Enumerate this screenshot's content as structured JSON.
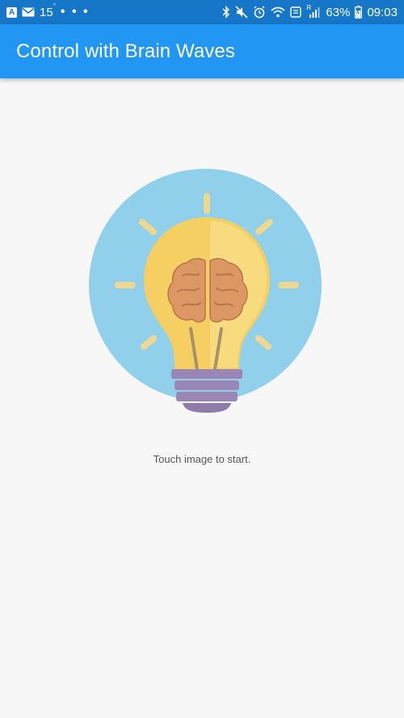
{
  "status_bar": {
    "notification_badge": "A",
    "temperature": "15",
    "temperature_unit": "°",
    "more_dots": "• • •",
    "battery_percent": "63%",
    "time": "09:03",
    "signal_label": "R"
  },
  "app_bar": {
    "title": "Control with Brain Waves"
  },
  "main": {
    "hint_text": "Touch image to start."
  },
  "icons": {
    "hero_image": "lightbulb-brain-icon"
  },
  "colors": {
    "status_bar_bg": "#1677c9",
    "app_bar_bg": "#2196f3",
    "page_bg": "#f7f7f7",
    "circle_bg": "#90d0ea",
    "bulb_glass": "#f6d36b",
    "brain": "#d99562",
    "bulb_base": "#9a86b6"
  }
}
